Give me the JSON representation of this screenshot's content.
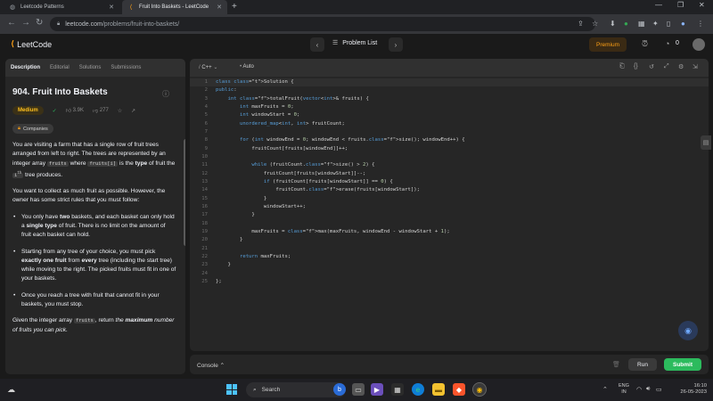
{
  "browser": {
    "tabs": [
      {
        "title": "Leetcode Patterns",
        "active": false
      },
      {
        "title": "Fruit Into Baskets - LeetCode",
        "active": true
      }
    ],
    "url_host": "leetcode.com",
    "url_path": "/problems/fruit-into-baskets/"
  },
  "header": {
    "logo_text": "LeetCode",
    "problem_list_label": "Problem List",
    "premium_label": "Premium",
    "coins": "0"
  },
  "left": {
    "tabs": [
      "Description",
      "Editorial",
      "Solutions",
      "Submissions"
    ],
    "title": "904. Fruit Into Baskets",
    "difficulty": "Medium",
    "likes": "3.9K",
    "dislikes": "277",
    "companies_label": "Companies",
    "desc": {
      "p1a": "You are visiting a farm that has a single row of fruit trees arranged from left to right. The trees are represented by an integer array ",
      "p1code1": "fruits",
      "p1b": " where ",
      "p1code2": "fruits[i]",
      "p1c": " is the ",
      "p1bold": "type",
      "p1d": " of fruit the ",
      "p1e": " tree produces.",
      "p1sup": "th",
      "p2": "You want to collect as much fruit as possible. However, the owner has some strict rules that you must follow:",
      "li1a": "You only have ",
      "li1b": "two",
      "li1c": " baskets, and each basket can only hold a ",
      "li1d": "single type",
      "li1e": " of fruit. There is no limit on the amount of fruit each basket can hold.",
      "li2a": "Starting from any tree of your choice, you must pick ",
      "li2b": "exactly one fruit",
      "li2c": " from ",
      "li2d": "every",
      "li2e": " tree (including the start tree) while moving to the right. The picked fruits must fit in one of your baskets.",
      "li3": "Once you reach a tree with fruit that cannot fit in your baskets, you must stop.",
      "p3a": "Given the integer array ",
      "p3code": "fruits",
      "p3b": ", return ",
      "p3c": "the ",
      "p3d": "maximum",
      "p3e": " number of fruits you can pick."
    }
  },
  "editor": {
    "language": "C++",
    "mode": "Auto",
    "lines": [
      "class Solution {",
      "public:",
      "    int totalFruit(vector<int>& fruits) {",
      "        int maxFruits = 0;",
      "        int windowStart = 0;",
      "        unordered_map<int, int> fruitCount;",
      "",
      "        for (int windowEnd = 0; windowEnd < fruits.size(); windowEnd++) {",
      "            fruitCount[fruits[windowEnd]]++;",
      "",
      "            while (fruitCount.size() > 2) {",
      "                fruitCount[fruits[windowStart]]--;",
      "                if (fruitCount[fruits[windowStart]] == 0) {",
      "                    fruitCount.erase(fruits[windowStart]);",
      "                }",
      "                windowStart++;",
      "            }",
      "",
      "            maxFruits = max(maxFruits, windowEnd - windowStart + 1);",
      "        }",
      "",
      "        return maxFruits;",
      "    }",
      "",
      "};"
    ]
  },
  "console": {
    "label": "Console",
    "run_label": "Run",
    "submit_label": "Submit"
  },
  "taskbar": {
    "search_label": "Search",
    "lang_top": "ENG",
    "lang_bottom": "IN",
    "time": "16:10",
    "date": "26-05-2023"
  }
}
